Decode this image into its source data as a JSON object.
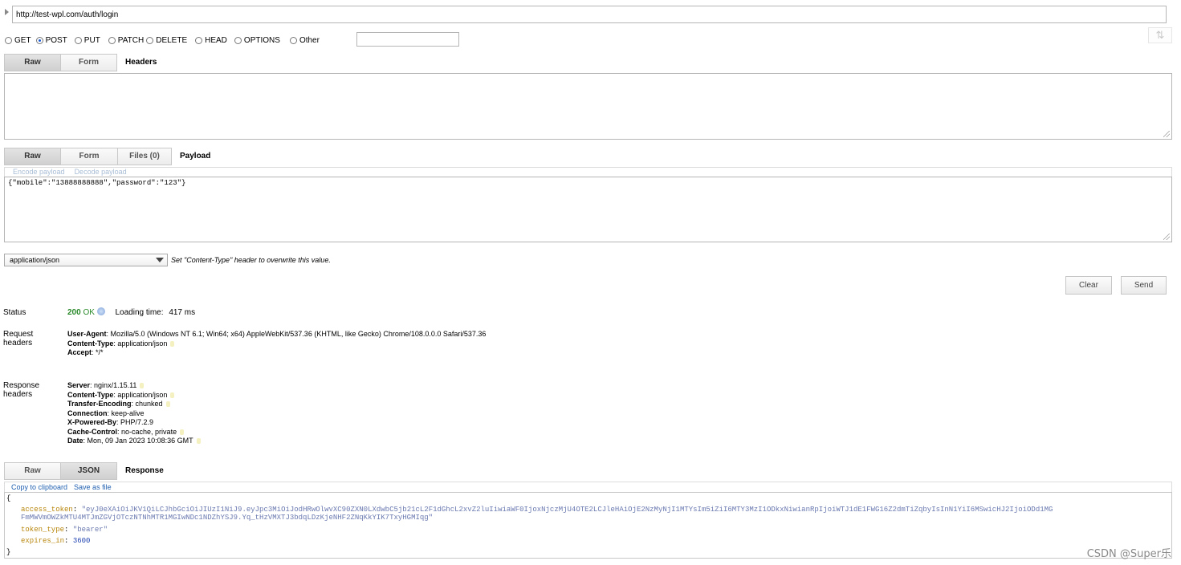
{
  "request": {
    "url": "http://test-wpl.com/auth/login",
    "methods": [
      {
        "label": "GET",
        "selected": false
      },
      {
        "label": "POST",
        "selected": true
      },
      {
        "label": "PUT",
        "selected": false
      },
      {
        "label": "PATCH",
        "selected": false
      },
      {
        "label": "DELETE",
        "selected": false
      },
      {
        "label": "HEAD",
        "selected": false
      },
      {
        "label": "OPTIONS",
        "selected": false
      },
      {
        "label": "Other",
        "selected": false
      }
    ],
    "other_method_value": ""
  },
  "headers_section": {
    "tabs": [
      "Raw",
      "Form"
    ],
    "title": "Headers",
    "value": ""
  },
  "payload_section": {
    "tabs": [
      "Raw",
      "Form",
      "Files (0)"
    ],
    "title": "Payload",
    "encode_link": "Encode payload",
    "decode_link": "Decode payload",
    "value": "{\"mobile\":\"13888888888\",\"password\":\"123\"}"
  },
  "content_type": {
    "selected": "application/json",
    "note": "Set \"Content-Type\" header to overwrite this value."
  },
  "actions": {
    "clear_label": "Clear",
    "send_label": "Send"
  },
  "status": {
    "label": "Status",
    "code": "200",
    "text": "OK",
    "loading_label": "Loading time:",
    "loading_value": "417 ms"
  },
  "request_headers": {
    "label_line1": "Request",
    "label_line2": "headers",
    "items": [
      {
        "key": "User-Agent",
        "value": "Mozilla/5.0 (Windows NT 6.1; Win64; x64) AppleWebKit/537.36 (KHTML, like Gecko) Chrome/108.0.0.0 Safari/537.36"
      },
      {
        "key": "Content-Type",
        "value": "application/json"
      },
      {
        "key": "Accept",
        "value": "*/*"
      }
    ]
  },
  "response_headers": {
    "label_line1": "Response",
    "label_line2": "headers",
    "items": [
      {
        "key": "Server",
        "value": "nginx/1.15.11"
      },
      {
        "key": "Content-Type",
        "value": "application/json"
      },
      {
        "key": "Transfer-Encoding",
        "value": "chunked"
      },
      {
        "key": "Connection",
        "value": "keep-alive"
      },
      {
        "key": "X-Powered-By",
        "value": "PHP/7.2.9"
      },
      {
        "key": "Cache-Control",
        "value": "no-cache, private"
      },
      {
        "key": "Date",
        "value": "Mon, 09 Jan 2023 10:08:36 GMT"
      }
    ]
  },
  "response_section": {
    "tabs": [
      "Raw",
      "JSON"
    ],
    "title": "Response",
    "copy_link": "Copy to clipboard",
    "save_link": "Save as file",
    "open_brace": "{",
    "close_brace": "}",
    "fields": {
      "access_token_key": "access_token",
      "access_token_value_line1": "\"eyJ0eXAiOiJKV1QiLCJhbGciOiJIUzI1NiJ9.eyJpc3MiOiJodHRwOlwvXC90ZXN0LXdwbC5jb21cL2F1dGhcL2xvZ2luIiwiaWF0IjoxNjczMjU4OTE2LCJleHAiOjE2NzMyNjI1MTYsIm5iZiI6MTY3MzI1ODkxNiwianRpIjoiWTJ1dE1FWG16Z2dmTiZqbyIsInN1YiI6MSwicHJ2IjoiODd1MG",
      "access_token_value_line2": "FmMWVmOWZkMTU4MTJmZGVjOTczNTNhMTR1MGIwNDc1NDZhYSJ9.Yq_tHzVMXTJ3bdqLDzKjeNHF2ZNqKkYIK7TxyHGMIqg\"",
      "token_type_key": "token_type",
      "token_type_value": "\"bearer\"",
      "expires_in_key": "expires_in",
      "expires_in_value": "3600"
    }
  },
  "watermark": "CSDN @Super乐",
  "colors": {
    "status_ok": "#2a8a2a",
    "link": "#1f5fb0",
    "json_key": "#b8860b",
    "json_string": "#6a79b0",
    "json_number": "#1b3fb0"
  }
}
